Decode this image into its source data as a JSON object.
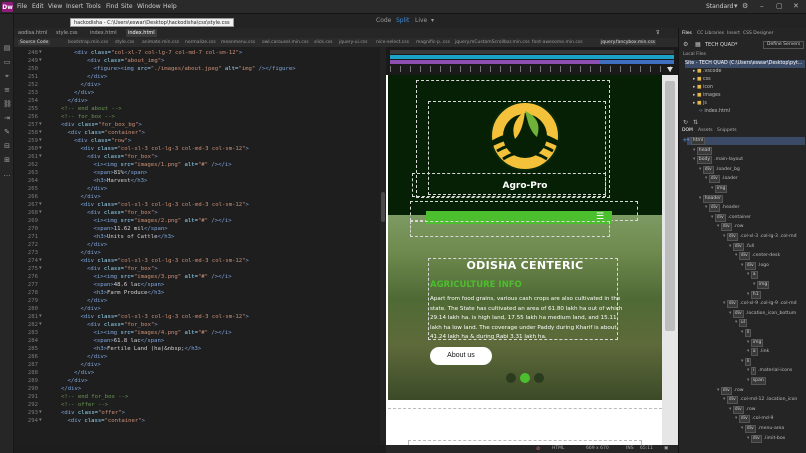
{
  "app": {
    "logo": "Dw"
  },
  "menu": [
    "File",
    "Edit",
    "View",
    "Insert",
    "Tools",
    "Find",
    "Site",
    "Window",
    "Help"
  ],
  "path_tooltip": "hackodisha - C:\\Users\\eswar\\Desktop\\hackodisha\\css\\style.css",
  "views": {
    "code": "Code",
    "split": "Split",
    "live": "Live"
  },
  "workspace": "Standard",
  "doc_tabs": [
    "aodisa.html",
    "style.css",
    "index.html",
    "index.html"
  ],
  "related_files": [
    "Source Code",
    "bootstrap.min.css",
    "style.css",
    "animate.min.css",
    "normalize.css",
    "meanmenu.css",
    "owl.carousel.min.css",
    "slick.css",
    "jquery-ui.css",
    "nice-select.css",
    "magnific-p..css",
    "jquery.mCustomScrollbar.min.css",
    "font-awesome.min.css",
    "jquery.fancybox.min.css"
  ],
  "code_lines": [
    {
      "n": "248",
      "f": "▼",
      "i": 4,
      "p": [
        [
          "<div ",
          "tag"
        ],
        [
          "class=",
          "attr"
        ],
        [
          "\"col-xl-7 col-lg-7 col-md-7 col-sm-12\"",
          "str"
        ],
        [
          ">",
          "tag"
        ]
      ]
    },
    {
      "n": "249",
      "f": "▼",
      "i": 6,
      "p": [
        [
          "<div ",
          "tag"
        ],
        [
          "class=",
          "attr"
        ],
        [
          "\"about_img\"",
          "str"
        ],
        [
          ">",
          "tag"
        ]
      ]
    },
    {
      "n": "250",
      "f": "",
      "i": 7,
      "p": [
        [
          "<figure><img ",
          "tag"
        ],
        [
          "src=",
          "attr"
        ],
        [
          "\"./images/about.jpeg\"",
          "str"
        ],
        [
          " alt=",
          "attr"
        ],
        [
          "\"img\"",
          "str"
        ],
        [
          " /></figure>",
          "tag"
        ]
      ]
    },
    {
      "n": "251",
      "f": "",
      "i": 6,
      "p": [
        [
          "</div>",
          "tag"
        ]
      ]
    },
    {
      "n": "252",
      "f": "",
      "i": 5,
      "p": [
        [
          "</div>",
          "tag"
        ]
      ]
    },
    {
      "n": "253",
      "f": "",
      "i": 4,
      "p": [
        [
          "</div>",
          "tag"
        ]
      ]
    },
    {
      "n": "254",
      "f": "",
      "i": 3,
      "p": [
        [
          "</div>",
          "tag"
        ]
      ]
    },
    {
      "n": "255",
      "f": "",
      "i": 2,
      "p": [
        [
          "<!-- end about -->",
          "cmt"
        ]
      ]
    },
    {
      "n": "256",
      "f": "",
      "i": 2,
      "p": [
        [
          "<!-- for_box -->",
          "cmt"
        ]
      ]
    },
    {
      "n": "257",
      "f": "▼",
      "i": 2,
      "p": [
        [
          "<div ",
          "tag"
        ],
        [
          "class=",
          "attr"
        ],
        [
          "\"for_box_bg\"",
          "str"
        ],
        [
          ">",
          "tag"
        ]
      ]
    },
    {
      "n": "258",
      "f": "▼",
      "i": 3,
      "p": [
        [
          "<div ",
          "tag"
        ],
        [
          "class=",
          "attr"
        ],
        [
          "\"container\"",
          "str"
        ],
        [
          ">",
          "tag"
        ]
      ]
    },
    {
      "n": "259",
      "f": "▼",
      "i": 4,
      "p": [
        [
          "<div ",
          "tag"
        ],
        [
          "class=",
          "attr"
        ],
        [
          "\"row\"",
          "str"
        ],
        [
          ">",
          "tag"
        ]
      ]
    },
    {
      "n": "260",
      "f": "▼",
      "i": 5,
      "p": [
        [
          "<div ",
          "tag"
        ],
        [
          "class=",
          "attr"
        ],
        [
          "\"col-xl-3 col-lg-3 col-md-3 col-sm-12\"",
          "str"
        ],
        [
          ">",
          "tag"
        ]
      ]
    },
    {
      "n": "261",
      "f": "▼",
      "i": 6,
      "p": [
        [
          "<div ",
          "tag"
        ],
        [
          "class=",
          "attr"
        ],
        [
          "\"for_box\"",
          "str"
        ],
        [
          ">",
          "tag"
        ]
      ]
    },
    {
      "n": "262",
      "f": "",
      "i": 7,
      "p": [
        [
          "<i><img ",
          "tag"
        ],
        [
          "src=",
          "attr"
        ],
        [
          "\"images/1.png\"",
          "str"
        ],
        [
          " alt=",
          "attr"
        ],
        [
          "\"#\"",
          "str"
        ],
        [
          " /></i>",
          "tag"
        ]
      ]
    },
    {
      "n": "263",
      "f": "",
      "i": 7,
      "p": [
        [
          "<span>",
          "tag"
        ],
        [
          "81%",
          "txt"
        ],
        [
          "</span>",
          "tag"
        ]
      ]
    },
    {
      "n": "264",
      "f": "",
      "i": 7,
      "p": [
        [
          "<h3>",
          "tag"
        ],
        [
          "Harvest",
          "txt"
        ],
        [
          "</h3>",
          "tag"
        ]
      ]
    },
    {
      "n": "265",
      "f": "",
      "i": 6,
      "p": [
        [
          "</div>",
          "tag"
        ]
      ]
    },
    {
      "n": "266",
      "f": "",
      "i": 5,
      "p": [
        [
          "</div>",
          "tag"
        ]
      ]
    },
    {
      "n": "267",
      "f": "▼",
      "i": 5,
      "p": [
        [
          "<div ",
          "tag"
        ],
        [
          "class=",
          "attr"
        ],
        [
          "\"col-xl-3 col-lg-3 col-md-3 col-sm-12\"",
          "str"
        ],
        [
          ">",
          "tag"
        ]
      ]
    },
    {
      "n": "268",
      "f": "▼",
      "i": 6,
      "p": [
        [
          "<div ",
          "tag"
        ],
        [
          "class=",
          "attr"
        ],
        [
          "\"for_box\"",
          "str"
        ],
        [
          ">",
          "tag"
        ]
      ]
    },
    {
      "n": "269",
      "f": "",
      "i": 7,
      "p": [
        [
          "<i><img ",
          "tag"
        ],
        [
          "src=",
          "attr"
        ],
        [
          "\"images/2.png\"",
          "str"
        ],
        [
          " alt=",
          "attr"
        ],
        [
          "\"#\"",
          "str"
        ],
        [
          " /></i>",
          "tag"
        ]
      ]
    },
    {
      "n": "270",
      "f": "",
      "i": 7,
      "p": [
        [
          "<span>",
          "tag"
        ],
        [
          "11.62 mil",
          "txt"
        ],
        [
          "</span>",
          "tag"
        ]
      ]
    },
    {
      "n": "271",
      "f": "",
      "i": 7,
      "p": [
        [
          "<h3>",
          "tag"
        ],
        [
          "Units of Cattle",
          "txt"
        ],
        [
          "</h3>",
          "tag"
        ]
      ]
    },
    {
      "n": "272",
      "f": "",
      "i": 6,
      "p": [
        [
          "</div>",
          "tag"
        ]
      ]
    },
    {
      "n": "273",
      "f": "",
      "i": 5,
      "p": [
        [
          "</div>",
          "tag"
        ]
      ]
    },
    {
      "n": "274",
      "f": "▼",
      "i": 5,
      "p": [
        [
          "<div ",
          "tag"
        ],
        [
          "class=",
          "attr"
        ],
        [
          "\"col-xl-3 col-lg-3 col-md-3 col-sm-12\"",
          "str"
        ],
        [
          ">",
          "tag"
        ]
      ]
    },
    {
      "n": "275",
      "f": "▼",
      "i": 6,
      "p": [
        [
          "<div ",
          "tag"
        ],
        [
          "class=",
          "attr"
        ],
        [
          "\"for_box\"",
          "str"
        ],
        [
          ">",
          "tag"
        ]
      ]
    },
    {
      "n": "276",
      "f": "",
      "i": 7,
      "p": [
        [
          "<i><img ",
          "tag"
        ],
        [
          "src=",
          "attr"
        ],
        [
          "\"images/3.png\"",
          "str"
        ],
        [
          " alt=",
          "attr"
        ],
        [
          "\"#\"",
          "str"
        ],
        [
          " /></i>",
          "tag"
        ]
      ]
    },
    {
      "n": "277",
      "f": "",
      "i": 7,
      "p": [
        [
          "<span>",
          "tag"
        ],
        [
          "48.6 lac",
          "txt"
        ],
        [
          "</span>",
          "tag"
        ]
      ]
    },
    {
      "n": "278",
      "f": "",
      "i": 7,
      "p": [
        [
          "<h3>",
          "tag"
        ],
        [
          "Farm Produce",
          "txt"
        ],
        [
          "</h3>",
          "tag"
        ]
      ]
    },
    {
      "n": "279",
      "f": "",
      "i": 6,
      "p": [
        [
          "</div>",
          "tag"
        ]
      ]
    },
    {
      "n": "280",
      "f": "",
      "i": 5,
      "p": [
        [
          "</div>",
          "tag"
        ]
      ]
    },
    {
      "n": "281",
      "f": "▼",
      "i": 5,
      "p": [
        [
          "<div ",
          "tag"
        ],
        [
          "class=",
          "attr"
        ],
        [
          "\"col-xl-3 col-lg-3 col-md-3 col-sm-12\"",
          "str"
        ],
        [
          ">",
          "tag"
        ]
      ]
    },
    {
      "n": "282",
      "f": "▼",
      "i": 6,
      "p": [
        [
          "<div ",
          "tag"
        ],
        [
          "class=",
          "attr"
        ],
        [
          "\"for_box\"",
          "str"
        ],
        [
          ">",
          "tag"
        ]
      ]
    },
    {
      "n": "283",
      "f": "",
      "i": 7,
      "p": [
        [
          "<i><img ",
          "tag"
        ],
        [
          "src=",
          "attr"
        ],
        [
          "\"images/4.png\"",
          "str"
        ],
        [
          " alt=",
          "attr"
        ],
        [
          "\"#\"",
          "str"
        ],
        [
          " /></i>",
          "tag"
        ]
      ]
    },
    {
      "n": "284",
      "f": "",
      "i": 7,
      "p": [
        [
          "<span>",
          "tag"
        ],
        [
          "61.8 lac",
          "txt"
        ],
        [
          "</span>",
          "tag"
        ]
      ]
    },
    {
      "n": "285",
      "f": "",
      "i": 7,
      "p": [
        [
          "<h3>",
          "tag"
        ],
        [
          "Fertile Land (ha)&nbsp;",
          "txt"
        ],
        [
          "</h3>",
          "tag"
        ]
      ]
    },
    {
      "n": "286",
      "f": "",
      "i": 6,
      "p": [
        [
          "</div>",
          "tag"
        ]
      ]
    },
    {
      "n": "287",
      "f": "",
      "i": 5,
      "p": [
        [
          "</div>",
          "tag"
        ]
      ]
    },
    {
      "n": "288",
      "f": "",
      "i": 4,
      "p": [
        [
          "</div>",
          "tag"
        ]
      ]
    },
    {
      "n": "289",
      "f": "",
      "i": 3,
      "p": [
        [
          "</div>",
          "tag"
        ]
      ]
    },
    {
      "n": "290",
      "f": "",
      "i": 2,
      "p": [
        [
          "</div>",
          "tag"
        ]
      ]
    },
    {
      "n": "291",
      "f": "",
      "i": 2,
      "p": [
        [
          "<!-- end for_box -->",
          "cmt"
        ]
      ]
    },
    {
      "n": "292",
      "f": "",
      "i": 2,
      "p": [
        [
          "<!-- offer -->",
          "cmt"
        ]
      ]
    },
    {
      "n": "293",
      "f": "▼",
      "i": 2,
      "p": [
        [
          "<div ",
          "tag"
        ],
        [
          "class=",
          "attr"
        ],
        [
          "\"offer\"",
          "str"
        ],
        [
          ">",
          "tag"
        ]
      ]
    },
    {
      "n": "294",
      "f": "▼",
      "i": 3,
      "p": [
        [
          "<div ",
          "tag"
        ],
        [
          "class=",
          "attr"
        ],
        [
          "\"container\"",
          "str"
        ],
        [
          ">",
          "tag"
        ]
      ]
    }
  ],
  "preview": {
    "brand": "Agro-Pro",
    "heading": "ODISHA CENTERIC",
    "subheading": "AGRICULTURE INFO",
    "paragraph": "Apart from food grains, various cash crops are also cultivated in the state. The State has cultivated an area of 61.80 lakh ha out of which 29.14 lakh ha. is high land, 17.55 lakh ha medium land, and 15.11 lakh ha low land. The coverage under Paddy during Kharif is about 41.24 lakh ha & during Rabi 3.31 lakh ha.",
    "button": "About us",
    "accent": "#4cbf2e"
  },
  "status": {
    "tag": "HTML",
    "size": "669 x 670",
    "mode": "INS",
    "pos": "65:11"
  },
  "panel": {
    "tabs": [
      "Files",
      "CC Libraries",
      "Insert",
      "CSS Designer"
    ],
    "site": "TECH QUAD",
    "manage": "Define Servers",
    "local_files": "Local Files",
    "site_root": "Site - TECH QUAD (C:\\Users\\eswar\\Desktop\\pyt...",
    "folders": [
      ".vscode",
      "css",
      "icon",
      "images",
      "js",
      "index.html"
    ],
    "dom_tabs": [
      "DOM",
      "Assets",
      "Snippets"
    ]
  },
  "dom_tree": [
    {
      "d": 0,
      "t": "html",
      "c": ""
    },
    {
      "d": 1,
      "t": "head",
      "c": ""
    },
    {
      "d": 1,
      "t": "body",
      "c": ".main-layout"
    },
    {
      "d": 2,
      "t": "div",
      "c": ".loader_bg"
    },
    {
      "d": 3,
      "t": "div",
      "c": ".loader"
    },
    {
      "d": 4,
      "t": "img",
      "c": ""
    },
    {
      "d": 2,
      "t": "header",
      "c": ""
    },
    {
      "d": 3,
      "t": "div",
      "c": ".header"
    },
    {
      "d": 4,
      "t": "div",
      "c": ".container"
    },
    {
      "d": 5,
      "t": "div",
      "c": ".row"
    },
    {
      "d": 6,
      "t": "div",
      "c": ".col-xl-3 .col-lg-3 .col-md"
    },
    {
      "d": 7,
      "t": "div",
      "c": ".full"
    },
    {
      "d": 8,
      "t": "div",
      "c": ".center-desk"
    },
    {
      "d": 9,
      "t": "div",
      "c": ".logo"
    },
    {
      "d": 10,
      "t": "a",
      "c": ""
    },
    {
      "d": 11,
      "t": "img",
      "c": ""
    },
    {
      "d": 10,
      "t": "h1",
      "c": ""
    },
    {
      "d": 6,
      "t": "div",
      "c": ".col-xl-9 .col-lg-9 .col-md"
    },
    {
      "d": 7,
      "t": "div",
      "c": ".location_icon_bottum"
    },
    {
      "d": 8,
      "t": "ul",
      "c": ""
    },
    {
      "d": 9,
      "t": "li",
      "c": ""
    },
    {
      "d": 10,
      "t": "img",
      "c": ""
    },
    {
      "d": 10,
      "t": "a",
      "c": ".link"
    },
    {
      "d": 9,
      "t": "li",
      "c": ""
    },
    {
      "d": 10,
      "t": "i",
      "c": ".material-icons"
    },
    {
      "d": 10,
      "t": "span",
      "c": ""
    },
    {
      "d": 5,
      "t": "div",
      "c": ".row"
    },
    {
      "d": 6,
      "t": "div",
      "c": ".col-md-12 .location_icon"
    },
    {
      "d": 7,
      "t": "div",
      "c": ".row"
    },
    {
      "d": 8,
      "t": "div",
      "c": ".col-md-9"
    },
    {
      "d": 9,
      "t": "div",
      "c": ".menu-area"
    },
    {
      "d": 10,
      "t": "div",
      "c": ".limit-box"
    }
  ]
}
